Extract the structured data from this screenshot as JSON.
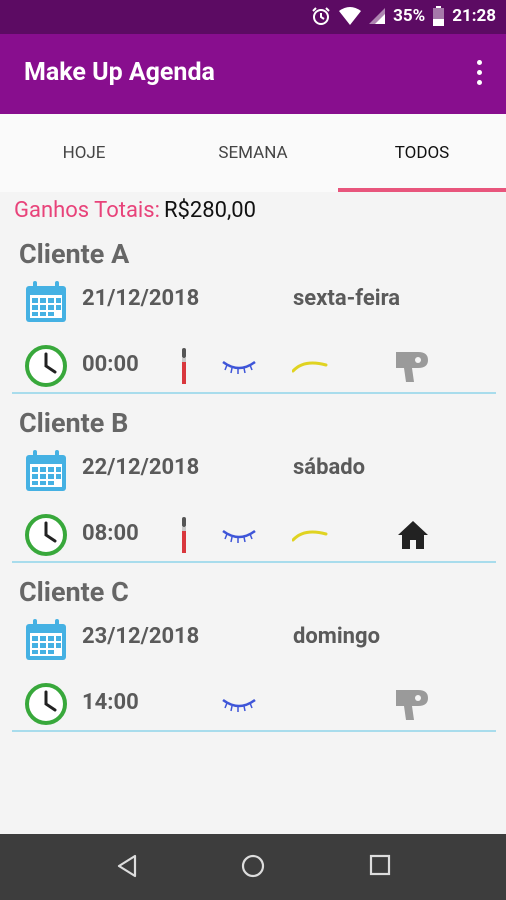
{
  "status_bar": {
    "battery_percent": "35%",
    "time": "21:28",
    "icons": [
      "alarm-icon",
      "wifi-icon",
      "signal-icon",
      "battery-icon"
    ]
  },
  "app_bar": {
    "title": "Make Up Agenda",
    "menu_icon": "more-vert-icon"
  },
  "tabs": [
    {
      "label": "HOJE",
      "active": false
    },
    {
      "label": "SEMANA",
      "active": false
    },
    {
      "label": "TODOS",
      "active": true
    }
  ],
  "summary": {
    "label": "Ganhos Totais:",
    "value": "R$280,00"
  },
  "appointments": [
    {
      "client": "Cliente A",
      "date": "21/12/2018",
      "weekday": "sexta-feira",
      "time": "00:00",
      "services": [
        "makeup-brush-icon",
        "eyelash-icon",
        "eyebrow-icon",
        "hair-dryer-icon"
      ]
    },
    {
      "client": "Cliente B",
      "date": "22/12/2018",
      "weekday": "sábado",
      "time": "08:00",
      "services": [
        "makeup-brush-icon",
        "eyelash-icon",
        "eyebrow-icon",
        "home-icon"
      ]
    },
    {
      "client": "Cliente C",
      "date": "23/12/2018",
      "weekday": "domingo",
      "time": "14:00",
      "services": [
        "eyelash-icon",
        "hair-dryer-icon"
      ]
    }
  ],
  "nav_bar": [
    "back-icon",
    "home-circle-icon",
    "recents-icon"
  ],
  "colors": {
    "status_bar": "#5c0b63",
    "app_bar": "#880e8e",
    "tab_indicator": "#e8557c",
    "summary_label": "#e8437a",
    "divider": "#a8dcec",
    "calendar_icon": "#45b1e3",
    "clock_icon": "#38a83b"
  }
}
